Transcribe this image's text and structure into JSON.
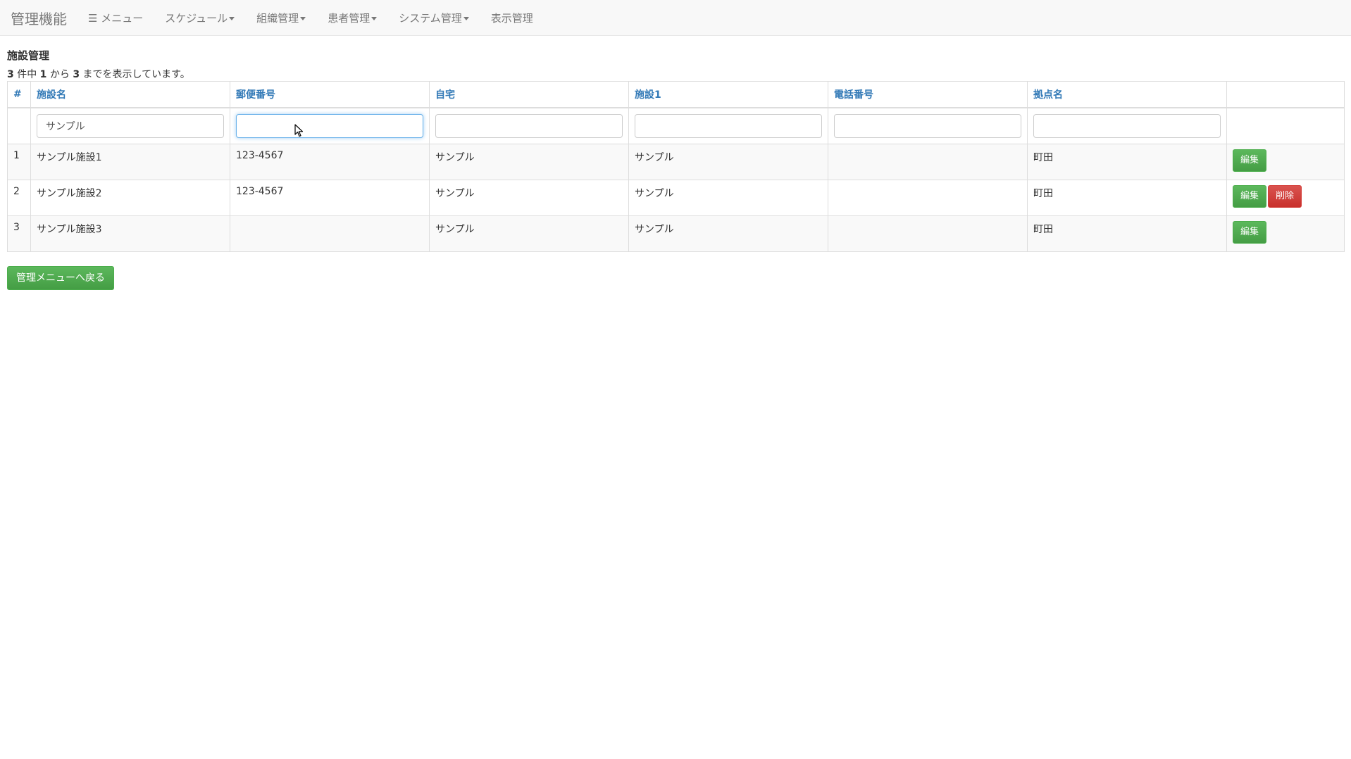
{
  "navbar": {
    "brand": "管理機能",
    "menu": "☰ メニュー",
    "schedule": "スケジュール",
    "organization": "組織管理",
    "patient": "患者管理",
    "system": "システム管理",
    "display": "表示管理"
  },
  "page": {
    "title": "施設管理",
    "summary": {
      "total": "3",
      "part1": " 件中 ",
      "from": "1",
      "part2": " から ",
      "to": "3",
      "part3": " までを表示しています。"
    }
  },
  "table": {
    "headers": [
      "#",
      "施設名",
      "郵便番号",
      "自宅",
      "施設1",
      "電話番号",
      "拠点名",
      ""
    ],
    "filters": {
      "name": "サンプル",
      "postal": "",
      "home": "",
      "facility1": "",
      "phone": "",
      "base": ""
    },
    "rows": [
      {
        "no": "1",
        "name": "サンプル施設1",
        "postal": "123-4567",
        "home": "サンプル",
        "facility1": "サンプル",
        "phone": "",
        "base": "町田"
      },
      {
        "no": "2",
        "name": "サンプル施設2",
        "postal": "123-4567",
        "home": "サンプル",
        "facility1": "サンプル",
        "phone": "",
        "base": "町田"
      },
      {
        "no": "3",
        "name": "サンプル施設3",
        "postal": "",
        "home": "サンプル",
        "facility1": "サンプル",
        "phone": "",
        "base": "町田"
      }
    ],
    "edit_label": "編集",
    "delete_label": "削除"
  },
  "back_button": "管理メニューへ戻る",
  "colors": {
    "primary_link": "#337ab7",
    "success": "#5cb85c",
    "danger": "#d9534f"
  }
}
